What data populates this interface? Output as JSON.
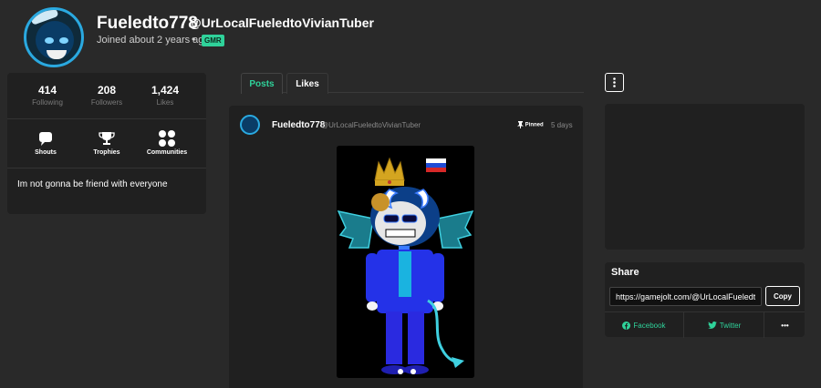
{
  "profile": {
    "name": "Fueledto778",
    "handle": "@UrLocalFueledtoVivianTuber",
    "joined": "Joined about 2 years ago",
    "separator": "•",
    "badge": "GMR"
  },
  "stats": [
    {
      "value": "414",
      "label": "Following"
    },
    {
      "value": "208",
      "label": "Followers"
    },
    {
      "value": "1,424",
      "label": "Likes"
    }
  ],
  "actions": [
    {
      "label": "Shouts",
      "icon": "chat-bubble-icon"
    },
    {
      "label": "Trophies",
      "icon": "trophy-icon"
    },
    {
      "label": "Communities",
      "icon": "communities-grid-icon"
    }
  ],
  "bio": "Im not gonna be friend with everyone",
  "tabs": {
    "posts": "Posts",
    "likes": "Likes"
  },
  "post": {
    "author": "Fueledto778",
    "handle": "@UrLocalFueledtoVivianTuber",
    "pinned": "Pinned",
    "time": "5 days"
  },
  "share": {
    "title": "Share",
    "url": "https://gamejolt.com/@UrLocalFueledtoVivianTuber",
    "copy": "Copy",
    "facebook": "Facebook",
    "twitter": "Twitter",
    "more": "•••"
  },
  "colors": {
    "accent": "#2fd29a",
    "background": "#292929",
    "card": "#202020"
  }
}
